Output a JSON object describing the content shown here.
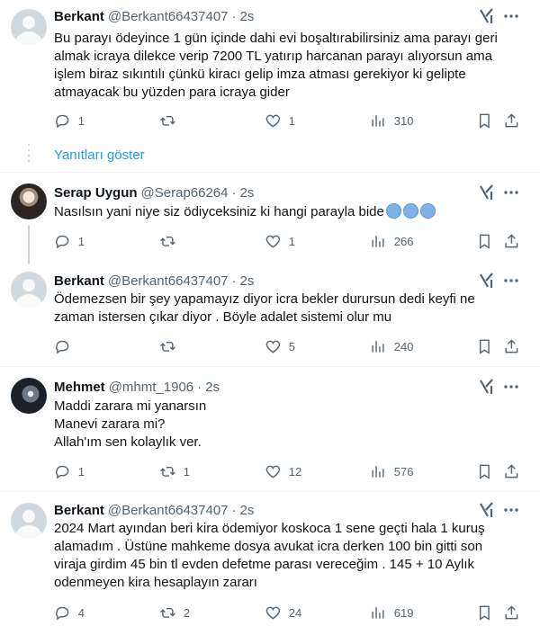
{
  "tweets": [
    {
      "name": "Berkant",
      "handle": "@Berkant66437407",
      "time": "2s",
      "text_lines": [
        "Bu parayı ödeyince 1 gün içinde dahi evi boşaltırabilirsiniz ama parayı geri",
        "almak icraya dilekce verip 7200 TL yatırıp harcanan parayı alıyorsun ama",
        "işlem biraz sıkıntılı çünkü kiracı gelip imza atması gerekiyor ki gelipte",
        "atmayacak bu yüzden para icraya gider"
      ],
      "replies": "1",
      "reposts": "",
      "likes": "1",
      "views": "310"
    },
    {
      "name": "Serap Uygun",
      "handle": "@Serap66264",
      "time": "2s",
      "text_lines": [
        "Nasılsın yani niye siz ödiyceksiniz ki hangi parayla bide"
      ],
      "replies": "1",
      "reposts": "",
      "likes": "1",
      "views": "266"
    },
    {
      "name": "Berkant",
      "handle": "@Berkant66437407",
      "time": "2s",
      "text_lines": [
        "Ödemezsen bir şey yapamayız diyor icra bekler durursun dedi keyfi ne",
        "zaman istersen çıkar diyor . Böyle adalet sistemi olur mu"
      ],
      "replies": "",
      "reposts": "",
      "likes": "5",
      "views": "240"
    },
    {
      "name": "Mehmet",
      "handle": "@mhmt_1906",
      "time": "2s",
      "text_lines": [
        "Maddi zarara mi yanarsın",
        "Manevi zarara mi?",
        "Allah'ım sen kolaylık ver."
      ],
      "replies": "1",
      "reposts": "1",
      "likes": "12",
      "views": "576"
    },
    {
      "name": "Berkant",
      "handle": "@Berkant66437407",
      "time": "2s",
      "text_lines": [
        "2024 Mart ayından beri kira ödemiyor koskoca 1 sene geçti hala 1 kuruş",
        "alamadım . Üstüne mahkeme dosya avukat icra derken 100 bin gitti son",
        "viraja girdim 45 bin tl evden defetme parası vereceğim . 145 + 10 Aylık",
        "odenmeyen kira hesaplayın zararı"
      ],
      "replies": "4",
      "reposts": "2",
      "likes": "24",
      "views": "619"
    }
  ],
  "show_replies_label": "Yanıtları göster",
  "dot": "·",
  "icons": {
    "reply": "reply-icon",
    "repost": "repost-icon",
    "like": "heart-icon",
    "views": "views-icon",
    "bookmark": "bookmark-icon",
    "share": "share-icon",
    "grok": "grok-icon",
    "more": "more-icon",
    "emoji": "cold-face-emoji"
  },
  "colors": {
    "text": "#0f1419",
    "secondary": "#536471",
    "link": "#1d9bf0",
    "divider": "#eff3f4",
    "thread_line": "#cfd9de"
  }
}
